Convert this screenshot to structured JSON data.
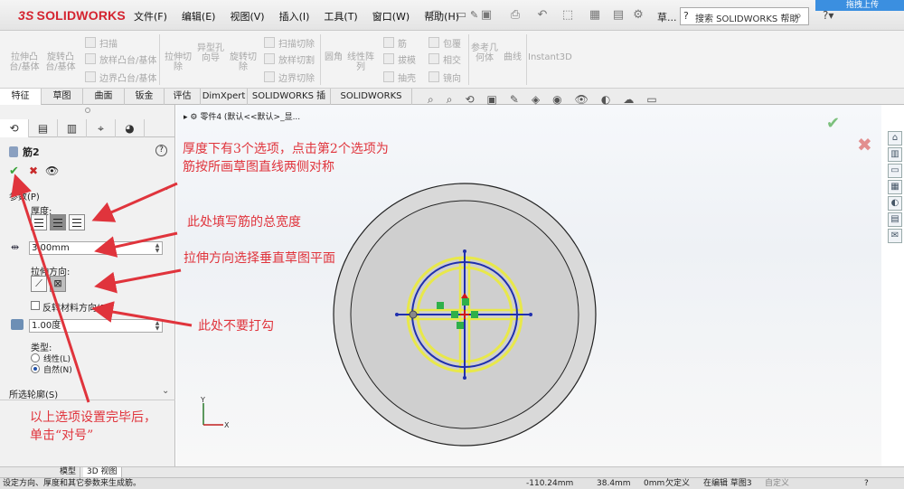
{
  "app": {
    "logo_text": "SOLIDWORKS",
    "logo_prefix": "3S",
    "upload_label": "拖拽上传"
  },
  "menu": [
    "文件(F)",
    "编辑(E)",
    "视图(V)",
    "插入(I)",
    "工具(T)",
    "窗口(W)",
    "帮助(H)"
  ],
  "menu_extra": "草...",
  "search": {
    "placeholder": "搜索 SOLIDWORKS 帮助"
  },
  "commands": {
    "extrude_boss": "拉伸凸台/基体",
    "revolve_boss": "旋转凸台/基体",
    "sweep": "扫描",
    "loft": "放样凸台/基体",
    "boundary_boss": "边界凸台/基体",
    "extrude_cut": "拉伸切除",
    "hole_wizard": "异型孔向导",
    "revolve_cut": "旋转切除",
    "swept_cut": "扫描切除",
    "lofted_cut": "放样切割",
    "boundary_cut": "边界切除",
    "fillet": "圆角",
    "linear_pattern": "线性阵列",
    "rib": "筋",
    "draft": "拔模",
    "shell": "抽壳",
    "wrap": "包覆",
    "intersect": "相交",
    "mirror": "镜向",
    "reference_geometry": "参考几何体",
    "curves": "曲线",
    "instant3d": "Instant3D"
  },
  "tabs": [
    "特征",
    "草图",
    "曲面",
    "钣金",
    "评估",
    "DimXpert",
    "SOLIDWORKS 插件",
    "SOLIDWORKS MBD"
  ],
  "feature_panel": {
    "title": "筋2",
    "params_section": "参数(P)",
    "thickness_label": "厚度:",
    "thickness_value": "3.00mm",
    "direction_label": "拉伸方向:",
    "flip_label": "反转材料方向(F)",
    "draft_value": "1.00度",
    "type_label": "类型:",
    "type_linear": "线性(L)",
    "type_natural": "自然(N)",
    "profiles_section": "所选轮廓(S)"
  },
  "viewport": {
    "breadcrumb": "零件4  (默认<<默认>_显...",
    "triad_y": "Y",
    "triad_x": "X"
  },
  "model_tabs": [
    "模型",
    "3D 视图"
  ],
  "status": {
    "message": "设定方向、厚度和其它参数来生成筋。",
    "x": "-110.24mm",
    "y": "38.4mm",
    "z": "0mm",
    "state": "欠定义",
    "editing": "在编辑 草图3",
    "custom": "自定义"
  },
  "annotations": {
    "note_thickness": [
      "厚度下有3个选项，点击第2个选项为",
      "筋按所画草图直线两侧对称"
    ],
    "note_total_width": "此处填写筋的总宽度",
    "note_direction": "拉伸方向选择垂直草图平面",
    "note_no_check": "此处不要打勾",
    "note_confirm": [
      "以上选项设置完毕后，",
      "单击“对号”"
    ]
  },
  "colors": {
    "annotation": "#e0343c",
    "logo": "#d4232f",
    "sketch_blue": "#1f2fae",
    "highlight_yellow": "#e8e84a",
    "part_gray": "#d6d6d6"
  }
}
